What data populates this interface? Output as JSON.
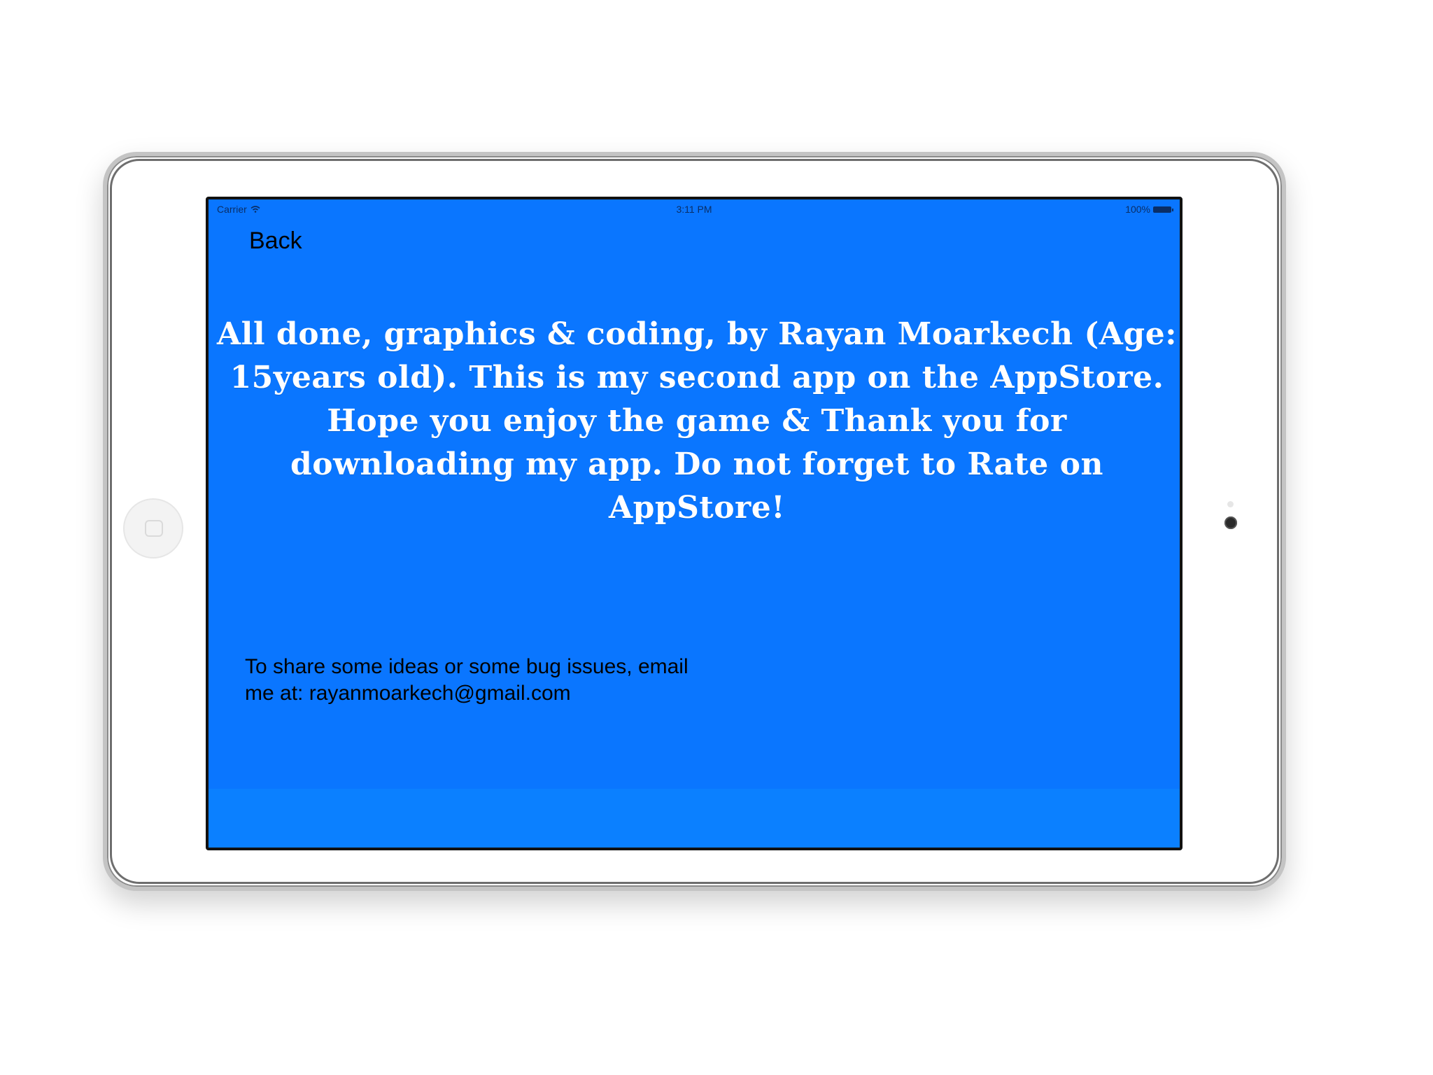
{
  "status_bar": {
    "carrier": "Carrier",
    "time": "3:11 PM",
    "battery_percent": "100%"
  },
  "nav": {
    "back_label": "Back"
  },
  "credits": {
    "message": "All done, graphics & coding, by Rayan Moarkech (Age: 15years old). This is my second app on the AppStore. Hope you enjoy the game & Thank you for downloading my app. Do not forget to Rate on AppStore!"
  },
  "contact": {
    "line1": "To share some ideas or some bug issues, email",
    "line2": "me at: rayanmoarkech@gmail.com"
  },
  "icons": {
    "wifi": "wifi-icon",
    "battery": "battery-icon",
    "home_button": "home-button-icon",
    "camera": "front-camera-icon"
  },
  "colors": {
    "screen_background": "#0a76ff",
    "message_text": "#ffffff",
    "body_text": "#000000"
  }
}
